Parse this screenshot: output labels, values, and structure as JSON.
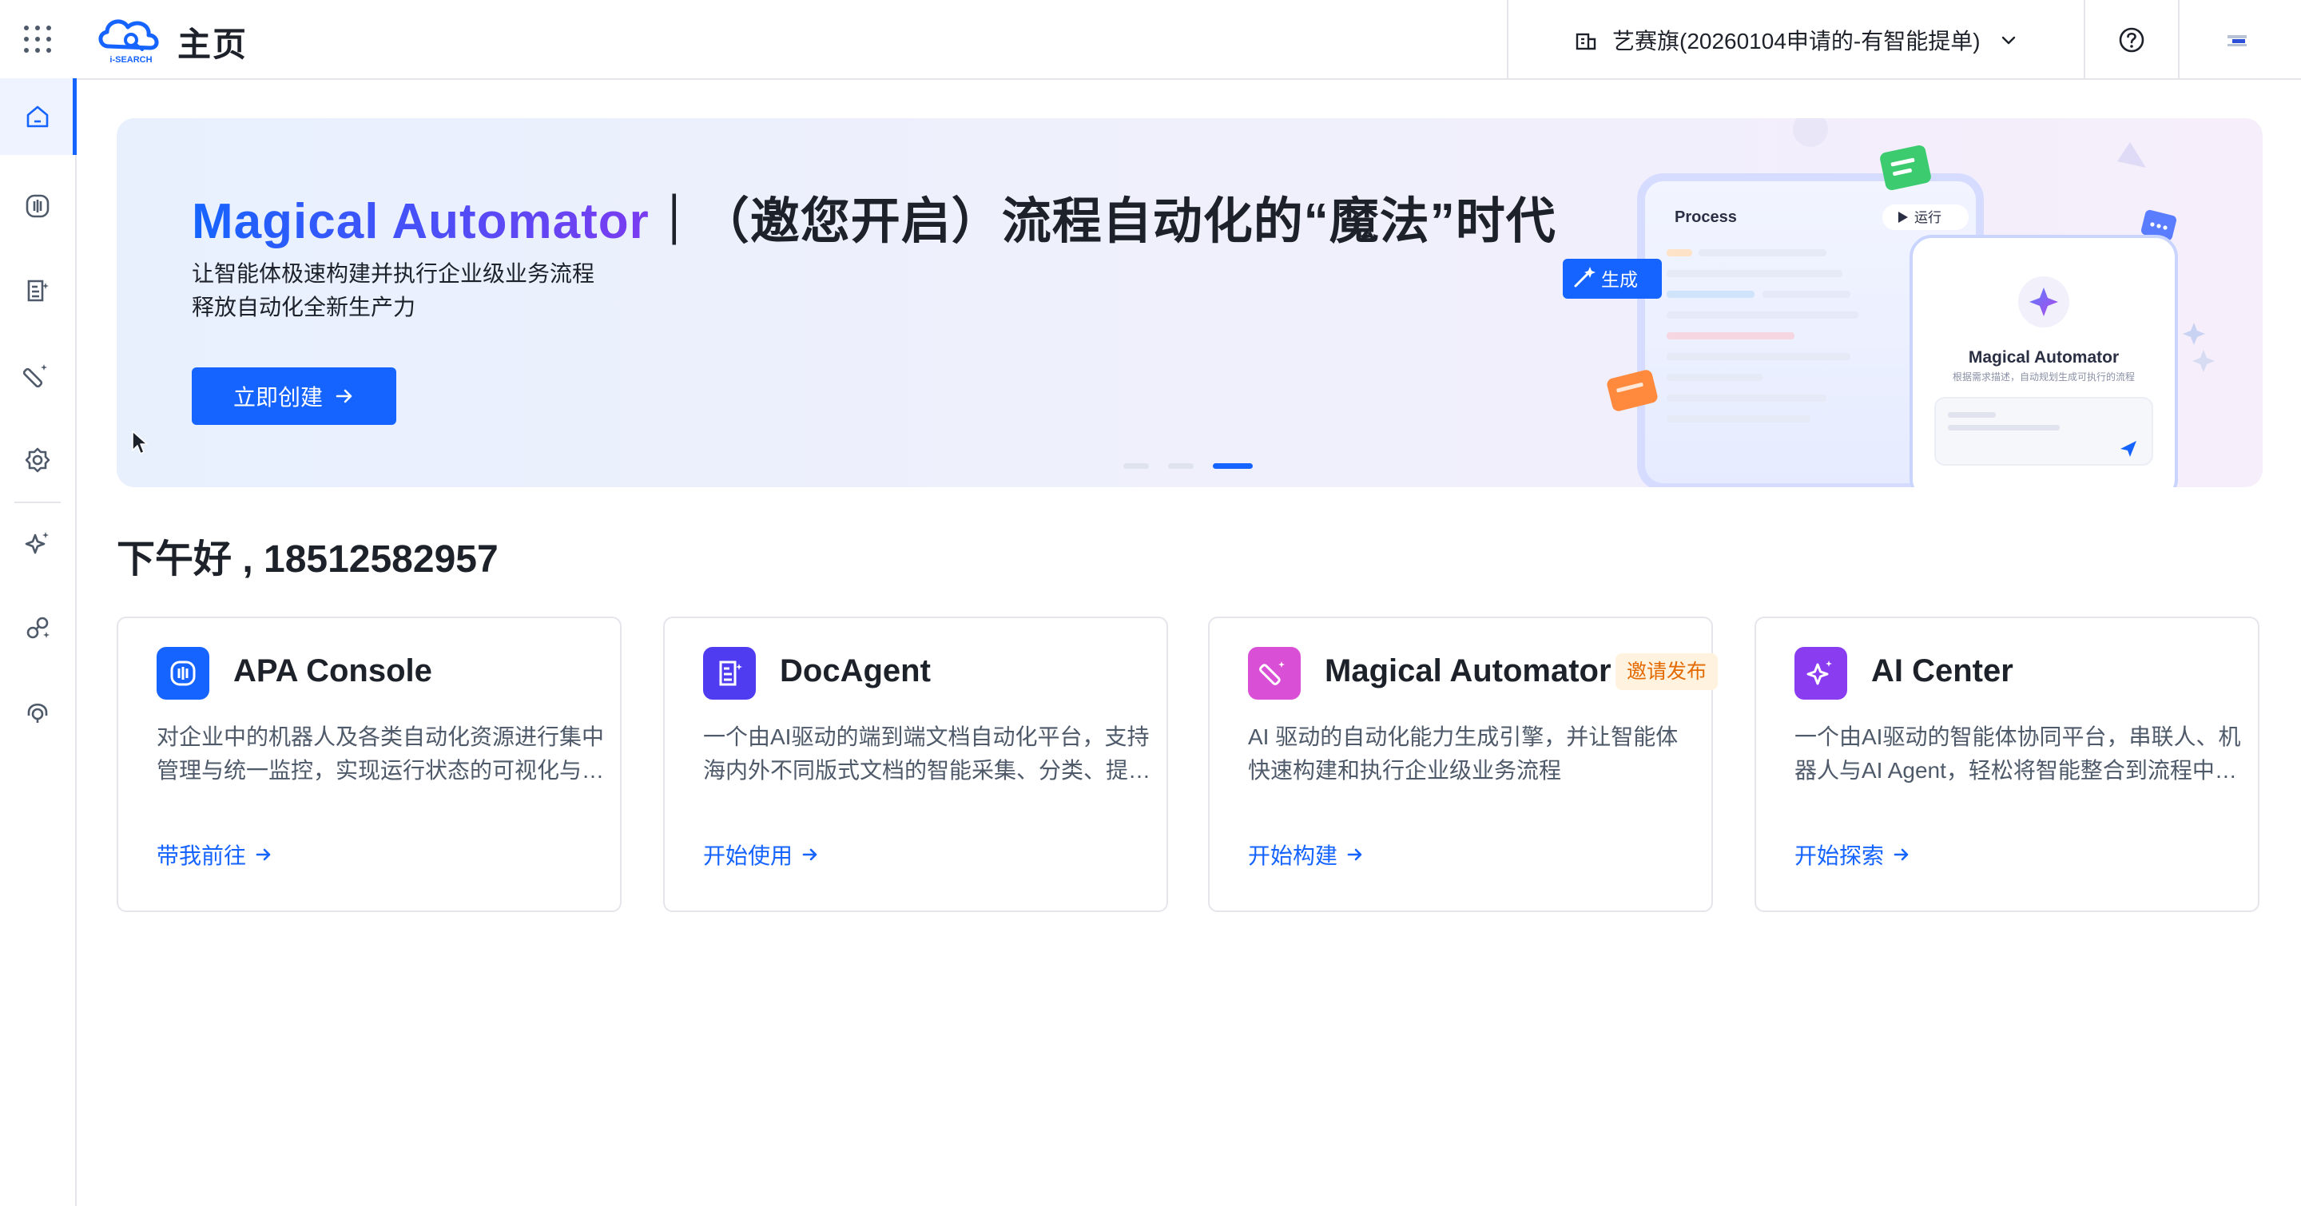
{
  "header": {
    "page_title": "主页",
    "org_name": "艺赛旗(20260104申请的-有智能提单)",
    "logo_text": "i-SEARCH"
  },
  "sidebar": {
    "items": [
      {
        "icon": "home-icon",
        "active": true
      },
      {
        "icon": "console-icon",
        "active": false
      },
      {
        "icon": "document-icon",
        "active": false
      },
      {
        "icon": "wand-icon",
        "active": false
      },
      {
        "icon": "gear-icon",
        "active": false
      },
      {
        "icon": "sparkle-icon",
        "active": false
      },
      {
        "icon": "robot-link-icon",
        "active": false
      },
      {
        "icon": "headset-icon",
        "active": false
      }
    ]
  },
  "banner": {
    "title_highlight": "Magical Automator",
    "title_rest": "｜（邀您开启）流程自动化的“魔法”时代",
    "subtitle_line1": "让智能体极速构建并执行企业级业务流程",
    "subtitle_line2": "释放自动化全新生产力",
    "cta_label": "立即创建",
    "art": {
      "process_label": "Process",
      "run_label": "运行",
      "generate_label": "生成",
      "panel_title": "Magical Automator",
      "panel_subtitle": "根据需求描述，自动规划生成可执行的流程"
    },
    "carousel_active_index": 3,
    "carousel_count": 3
  },
  "greeting": "下午好 , 18512582957",
  "cards": [
    {
      "title": "APA Console",
      "badge": "",
      "desc": "对企业中的机器人及各类自动化资源进行集中管理与统一监控，实现运行状态的可视化与…",
      "link": "带我前往",
      "color": "#1664ff",
      "icon": "console-icon"
    },
    {
      "title": "DocAgent",
      "badge": "",
      "desc": "一个由AI驱动的端到端文档自动化平台，支持海内外不同版式文档的智能采集、分类、提…",
      "link": "开始使用",
      "color": "#4f3cf0",
      "icon": "document-icon"
    },
    {
      "title": "Magical Automator",
      "badge": "邀请发布",
      "desc": "AI 驱动的自动化能力生成引擎，并让智能体快速构建和执行企业级业务流程",
      "link": "开始构建",
      "color": "#d94fd6",
      "icon": "wand-icon"
    },
    {
      "title": "AI Center",
      "badge": "",
      "desc": "一个由AI驱动的智能体协同平台，串联人、机器人与AI Agent，轻松将智能整合到流程中…",
      "link": "开始探索",
      "color": "#8a3cf0",
      "icon": "sparkle-icon"
    }
  ]
}
